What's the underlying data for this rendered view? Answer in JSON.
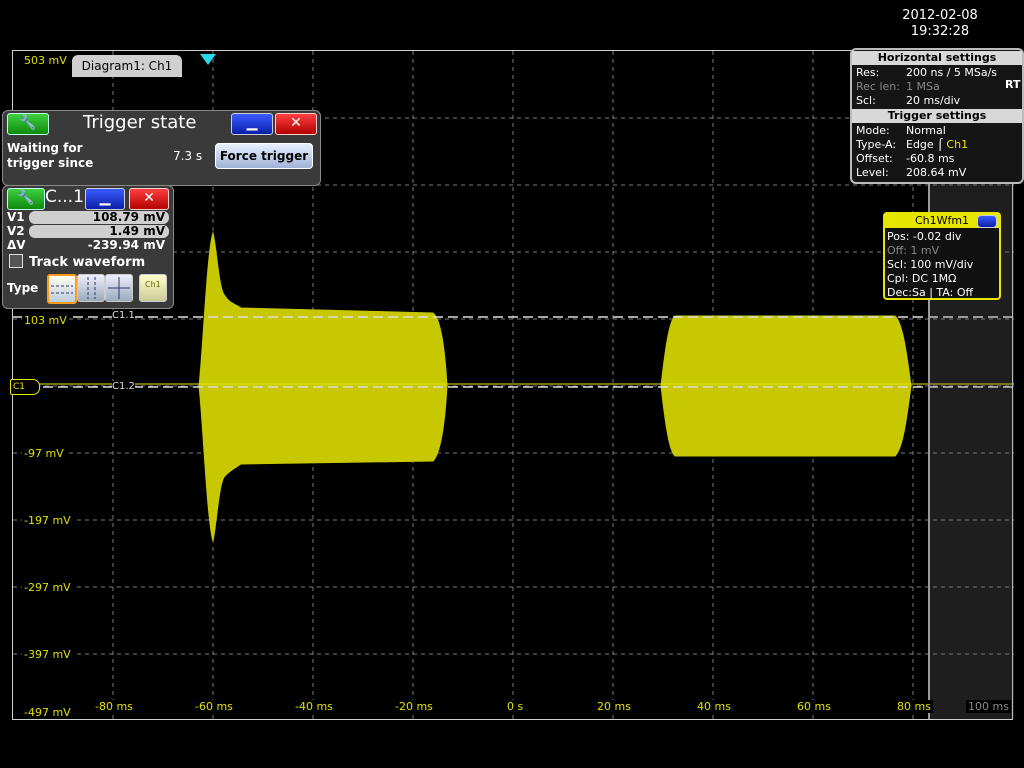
{
  "datetime": {
    "date": "2012-02-08",
    "time": "19:32:28"
  },
  "diagram": {
    "tab_label": "Diagram1: Ch1"
  },
  "y_axis": {
    "labels": [
      "503 mV",
      "103 mV",
      "-97 mV",
      "-197 mV",
      "-297 mV",
      "-397 mV",
      "-497 mV"
    ]
  },
  "x_axis": {
    "labels": [
      "-80 ms",
      "-60 ms",
      "-40 ms",
      "-20 ms",
      "0 s",
      "20 ms",
      "40 ms",
      "60 ms",
      "80 ms",
      "100 ms"
    ]
  },
  "markers": {
    "c11": "C1.1",
    "c12": "C1.2",
    "ch_ref": "C1"
  },
  "trigger_state": {
    "title": "Trigger state",
    "waiting_line1": "Waiting for",
    "waiting_line2": "trigger since",
    "time": "7.3 s",
    "force_label": "Force trigger",
    "min_icon": "minimize-icon",
    "close_icon": "close-icon",
    "tool_icon": "wrench-icon"
  },
  "cursor": {
    "title": "C...1",
    "v1_label": "V1",
    "v1_value": "108.79 mV",
    "v2_label": "V2",
    "v2_value": "1.49 mV",
    "dv_label": "ΔV",
    "dv_value": "-239.94 mV",
    "track_label": "Track waveform",
    "type_label": "Type"
  },
  "horizontal": {
    "title": "Horizontal settings",
    "res_k": "Res:",
    "res_v": "200 ns / 5 MSa/s",
    "rec_k": "Rec len:",
    "rec_v": "1 MSa",
    "scl_k": "Scl:",
    "scl_v": "20 ms/div",
    "rt": "RT"
  },
  "trigger": {
    "title": "Trigger settings",
    "mode_k": "Mode:",
    "mode_v": "Normal",
    "type_k": "Type-A:",
    "type_v": "Edge",
    "type_src": "Ch1",
    "off_k": "Offset:",
    "off_v": "-60.8 ms",
    "lev_k": "Level:",
    "lev_v": "208.64 mV"
  },
  "wfm": {
    "title": "Ch1Wfm1",
    "pos": "Pos: -0.02 div",
    "off": "Off: 1 mV",
    "scl": "Scl: 100 mV/div",
    "cpl": "Cpl: DC 1MΩ",
    "dec": "Dec:Sa | TA: Off"
  },
  "colors": {
    "trace": "#c8c800",
    "accent": "#e6e600",
    "cursor_line": "#ffffff"
  }
}
